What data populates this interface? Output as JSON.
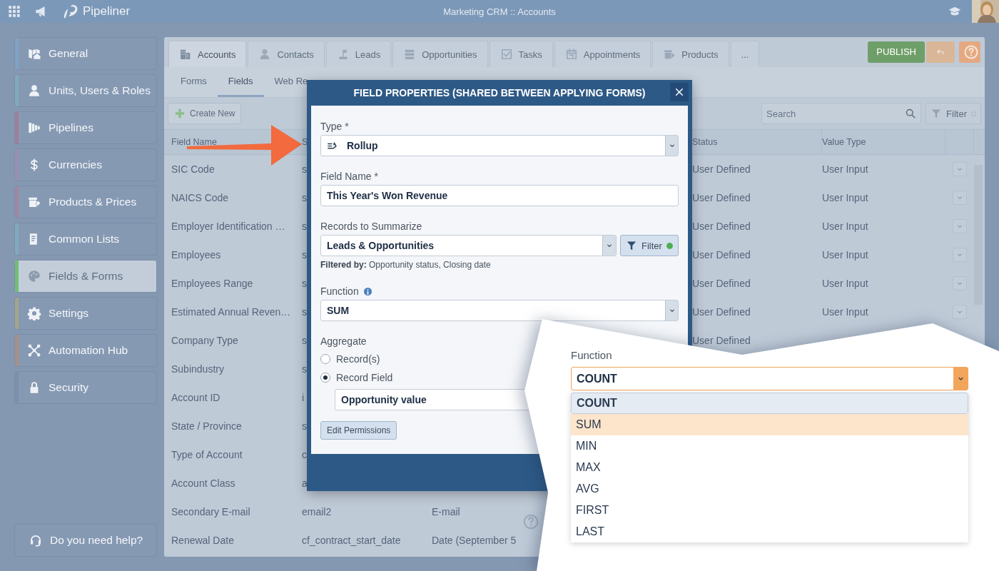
{
  "top_bar": {
    "app_name": "Pipeliner",
    "title": "Marketing CRM :: Accounts"
  },
  "sidebar": {
    "items": [
      {
        "label": "General",
        "color": "#7fa3c4",
        "selected": false
      },
      {
        "label": "Units, Users & Roles",
        "color": "#7eaabd",
        "selected": false
      },
      {
        "label": "Pipelines",
        "color": "#a07e99",
        "selected": false
      },
      {
        "label": "Currencies",
        "color": "#9a8fb6",
        "selected": false
      },
      {
        "label": "Products & Prices",
        "color": "#a0879f",
        "selected": false
      },
      {
        "label": "Common Lists",
        "color": "#7eaac0",
        "selected": false
      },
      {
        "label": "Fields & Forms",
        "color": "#6fbf73",
        "selected": true
      },
      {
        "label": "Settings",
        "color": "#a3a58a",
        "selected": false
      },
      {
        "label": "Automation Hub",
        "color": "#a98f86",
        "selected": false
      },
      {
        "label": "Security",
        "color": "#7f8fae",
        "selected": false
      }
    ],
    "help": "Do you need help?"
  },
  "tabs": [
    {
      "label": "Accounts",
      "selected": true
    },
    {
      "label": "Contacts",
      "selected": false
    },
    {
      "label": "Leads",
      "selected": false
    },
    {
      "label": "Opportunities",
      "selected": false
    },
    {
      "label": "Tasks",
      "selected": false
    },
    {
      "label": "Appointments",
      "selected": false
    },
    {
      "label": "Products",
      "selected": false
    },
    {
      "label": "...",
      "selected": false
    }
  ],
  "actions": {
    "publish": "PUBLISH"
  },
  "sub_tabs": [
    {
      "label": "Forms",
      "selected": false
    },
    {
      "label": "Fields",
      "selected": true
    },
    {
      "label": "Web Re",
      "selected": false
    }
  ],
  "toolbar": {
    "create": "Create New",
    "search_placeholder": "Search",
    "filter": "Filter",
    "filter_active": false
  },
  "table": {
    "columns": [
      {
        "label": "Field Name"
      },
      {
        "label": "S"
      },
      {},
      {
        "label": "Status"
      },
      {
        "label": "Value Type"
      }
    ],
    "rows": [
      {
        "field_name": "SIC Code",
        "column_2": "s",
        "status": "User Defined",
        "value_type": "User Input"
      },
      {
        "field_name": "NAICS Code",
        "column_2": "s",
        "status": "User Defined",
        "value_type": "User Input"
      },
      {
        "field_name": "Employer Identification …",
        "column_2": "s",
        "status": "User Defined",
        "value_type": "User Input"
      },
      {
        "field_name": "Employees",
        "column_2": "s",
        "status": "User Defined",
        "value_type": "User Input"
      },
      {
        "field_name": "Employees Range",
        "column_2": "s",
        "status": "User Defined",
        "value_type": "User Input"
      },
      {
        "field_name": "Estimated Annual Reven…",
        "column_2": "s",
        "status": "User Defined",
        "value_type": "User Input"
      },
      {
        "field_name": "Company Type",
        "column_2": "s",
        "status": "User Defined"
      },
      {
        "field_name": "Subindustry",
        "column_2": "s"
      },
      {
        "field_name": "Account ID",
        "column_2": "i"
      },
      {
        "field_name": "State / Province",
        "column_2": "s"
      },
      {
        "field_name": "Type of Account",
        "column_2": "c"
      },
      {
        "field_name": "Account Class",
        "column_2": "a"
      },
      {
        "field_name": "Secondary E-mail",
        "column_2": "email2",
        "column_3": "E-mail"
      },
      {
        "field_name": "Renewal Date",
        "column_2": "cf_contract_start_date",
        "column_3": "Date (September 5"
      }
    ]
  },
  "modal": {
    "title": "FIELD PROPERTIES (SHARED BETWEEN APPLYING FORMS)",
    "type_label": "Type *",
    "type_value": "Rollup",
    "name_label": "Field Name *",
    "name_value": "This Year's Won Revenue",
    "records_label": "Records to Summarize",
    "records_value": "Leads & Opportunities",
    "filter": "Filter",
    "filter_active": true,
    "filtered_by": "**Filtered by:** Opportunity status, Closing date",
    "function_label": "Function",
    "function_value": "SUM",
    "aggregate_label": "Aggregate",
    "aggregate_options": [
      {
        "label": "Record(s)",
        "selected": false
      },
      {
        "label": "Record Field",
        "selected": true
      }
    ],
    "field_value": "Opportunity value",
    "permissions": "Edit Permissions"
  },
  "callout": {
    "label": "Function",
    "value": "COUNT",
    "options": [
      {
        "label": "COUNT",
        "selected": true,
        "hovered": false
      },
      {
        "label": "SUM",
        "selected": false,
        "hovered": true
      },
      {
        "label": "MIN",
        "selected": false,
        "hovered": false
      },
      {
        "label": "MAX",
        "selected": false,
        "hovered": false
      },
      {
        "label": "AVG",
        "selected": false,
        "hovered": false
      },
      {
        "label": "FIRST",
        "selected": false,
        "hovered": false
      },
      {
        "label": "LAST",
        "selected": false,
        "hovered": false
      }
    ]
  }
}
